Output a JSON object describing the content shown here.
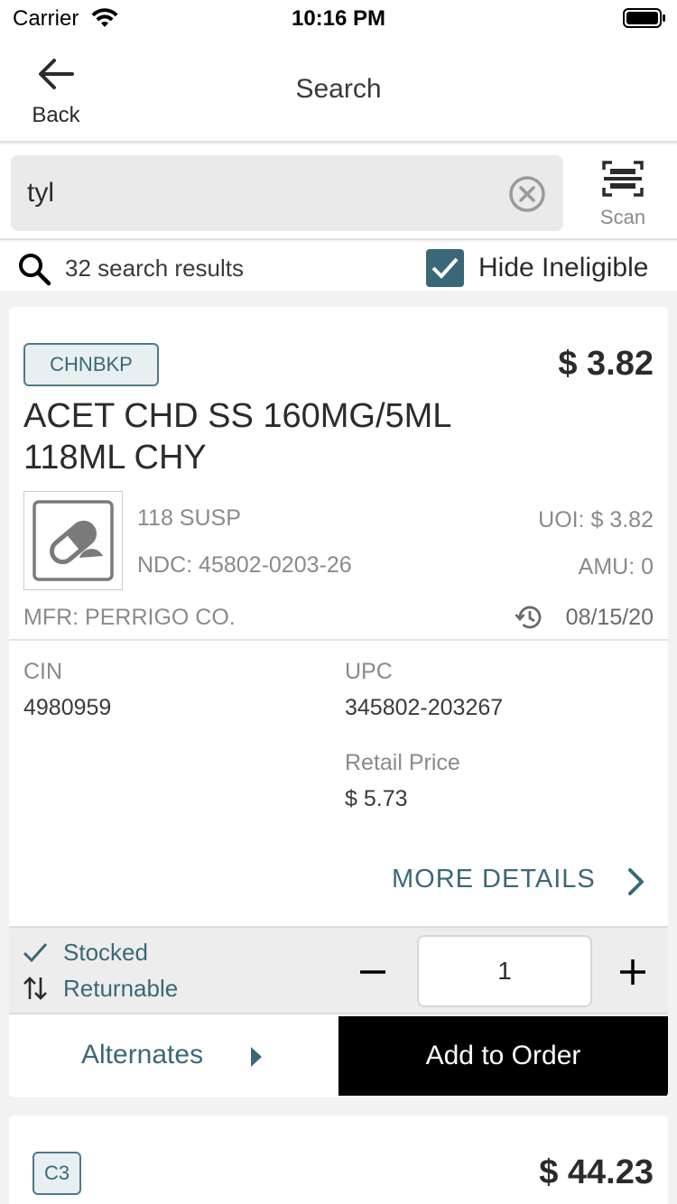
{
  "status_bar": {
    "carrier": "Carrier",
    "time": "10:16 PM"
  },
  "nav": {
    "back_label": "Back",
    "title": "Search"
  },
  "search": {
    "value": "tyl",
    "placeholder": "",
    "scan_label": "Scan"
  },
  "results": {
    "count_text": "32 search results",
    "hide_ineligible_label": "Hide Ineligible",
    "hide_ineligible_checked": true
  },
  "product": {
    "tag": "CHNBKP",
    "price": "$ 3.82",
    "name": "ACET CHD SS 160MG/5ML 118ML CHY",
    "package": "118 SUSP",
    "ndc": "NDC: 45802-0203-26",
    "uoi": "UOI: $ 3.82",
    "amu": "AMU: 0",
    "mfr": "MFR: PERRIGO CO.",
    "date": "08/15/20",
    "cin_label": "CIN",
    "cin_value": "4980959",
    "upc_label": "UPC",
    "upc_value": "345802-203267",
    "retail_label": "Retail Price",
    "retail_value": "$ 5.73",
    "more_details": "MORE DETAILS",
    "stocked_label": "Stocked",
    "returnable_label": "Returnable",
    "quantity": "1",
    "alternates_label": "Alternates",
    "add_to_order_label": "Add to Order"
  },
  "product2": {
    "tag": "C3",
    "price": "$ 44.23"
  },
  "colors": {
    "accent": "#3b6878",
    "tag_background": "#e7eff1",
    "add_button": "#000000"
  }
}
